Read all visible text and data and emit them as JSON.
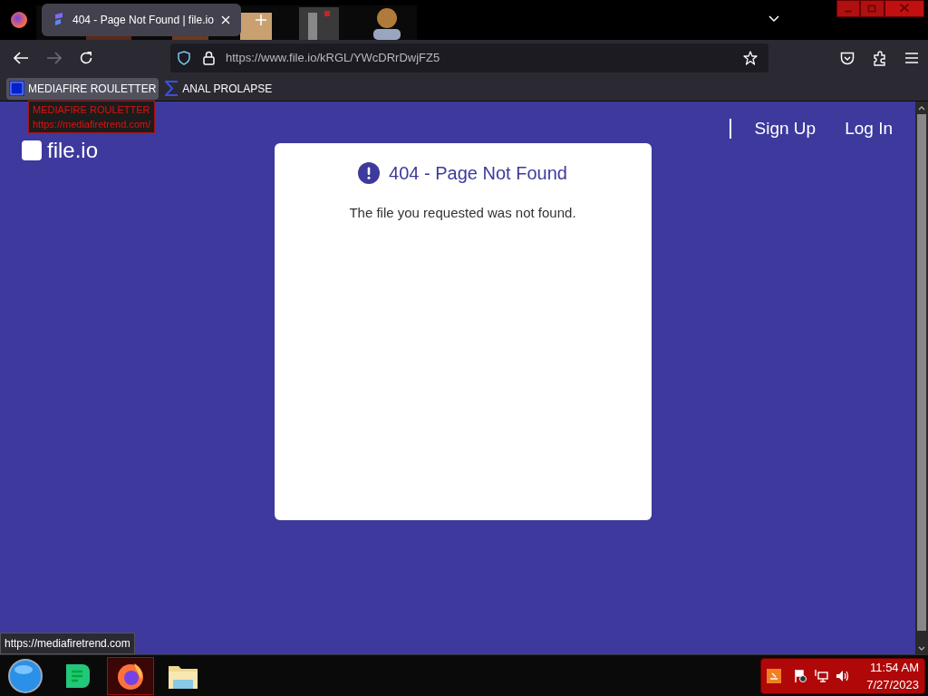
{
  "browser": {
    "tab": {
      "title": "404 - Page Not Found | file.io",
      "selected": true
    },
    "url": "https://www.file.io/kRGL/YWcDRrDwjFZ5",
    "bookmarks": [
      {
        "label": "MEDIAFIRE ROULETTER",
        "kind": "mft",
        "hovered": true
      },
      {
        "label": "ANAL PROLAPSE",
        "kind": "sigma",
        "hovered": false
      }
    ],
    "tooltip": {
      "title": "MEDIAFIRE ROULETTER",
      "url": "https://mediafiretrend.com/"
    },
    "status_url": "https://mediafiretrend.com"
  },
  "page": {
    "logo": "file.io",
    "nav": [
      "Sign Up",
      "Log In"
    ],
    "error": {
      "title": "404 - Page Not Found",
      "message": "The file you requested was not found."
    }
  },
  "taskbar": {
    "apps": [
      {
        "kind": "orb",
        "active": false
      },
      {
        "kind": "chat",
        "active": false
      },
      {
        "kind": "firefox",
        "active": true
      },
      {
        "kind": "folder",
        "active": false
      }
    ],
    "time": "11:54 AM",
    "date": "7/27/2023"
  }
}
